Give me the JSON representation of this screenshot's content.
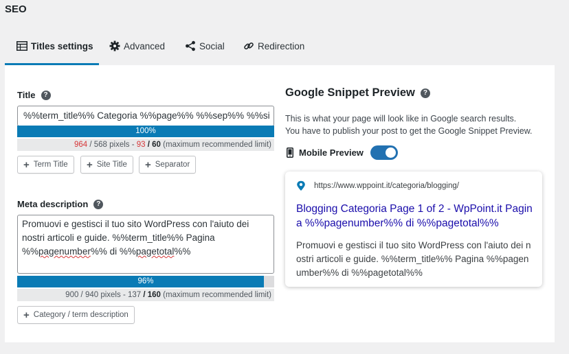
{
  "page": {
    "heading": "SEO"
  },
  "tabs": [
    {
      "label": "Titles settings",
      "icon": "table-icon",
      "active": true
    },
    {
      "label": "Advanced",
      "icon": "gear-icon",
      "active": false
    },
    {
      "label": "Social",
      "icon": "share-icon",
      "active": false
    },
    {
      "label": "Redirection",
      "icon": "link-icon",
      "active": false
    }
  ],
  "title_field": {
    "label": "Title",
    "value": "%%term_title%% Categoria %%page%% %%sep%% %%si",
    "progress_label": "100%",
    "progress": 1.0,
    "counter": {
      "pixels_used": "964",
      "pixels_max": "568 pixels",
      "chars_over": "93",
      "chars_max": "60",
      "note": "(maximum recommended limit)"
    },
    "buttons": [
      "Term Title",
      "Site Title",
      "Separator"
    ]
  },
  "meta_field": {
    "label": "Meta description",
    "value_line1": "Promuovi e gestisci il tuo sito WordPress con l'aiuto dei",
    "value_line2": "nostri articoli e guide. %%term_title%% Pagina",
    "value_line3_a": "%%",
    "value_line3_b": "pagenumber",
    "value_line3_c": "%% di %%",
    "value_line3_d": "pagetotal",
    "value_line3_e": "%%",
    "progress_label": "96%",
    "progress": 0.96,
    "counter": {
      "pixels_used": "900",
      "pixels_max": "940 pixels",
      "chars_over": "137",
      "chars_max": "160",
      "note": "(maximum recommended limit)"
    },
    "buttons": [
      "Category / term description"
    ]
  },
  "preview": {
    "title": "Google Snippet Preview",
    "description_line1": "This is what your page will look like in Google search results.",
    "description_line2": "You have to publish your post to get the Google Snippet Preview.",
    "mobile_label": "Mobile Preview",
    "mobile_enabled": true,
    "snippet": {
      "url": "https://www.wppoint.it/categoria/blogging/",
      "title": "Blogging Categoria Page 1 of 2 - WpPoint.it Pagina %%pagenumber%% di %%pagetotal%%",
      "description": "Promuovi e gestisci il tuo sito WordPress con l'aiuto dei nostri articoli e guide. %%term_title%% Pagina %%pagenumber%% di %%pagetotal%%"
    }
  },
  "colors": {
    "accent": "#0a7bb5",
    "toggle": "#2271b1",
    "link": "#1a0dab",
    "warning": "#d63638"
  }
}
